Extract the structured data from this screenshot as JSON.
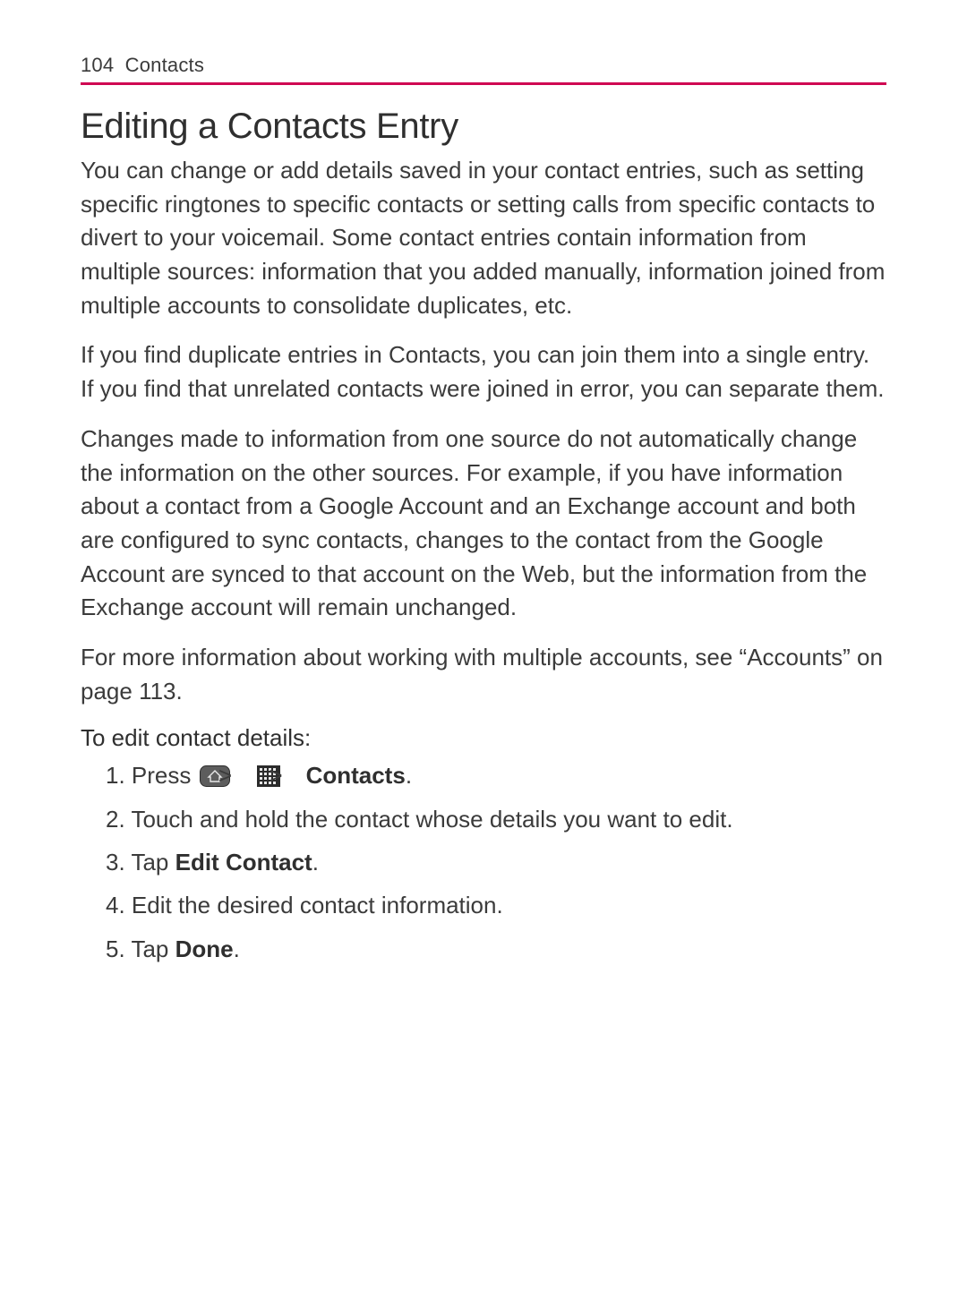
{
  "header": {
    "page_number": "104",
    "section": "Contacts"
  },
  "title": "Editing a Contacts Entry",
  "paragraphs": {
    "p1": "You can change or add details saved in your contact entries, such as setting specific ringtones to specific contacts or setting calls from specific contacts to divert to your voicemail. Some contact entries contain information from multiple sources: information that you added manually, information joined from multiple accounts to consolidate duplicates, etc.",
    "p2": "If you find duplicate entries in Contacts, you can join them into a single entry. If you find that unrelated contacts were joined in error, you can separate them.",
    "p3": "Changes made to information from one source do not automatically change the information on the other sources. For example, if you have information about a contact from a Google Account and an Exchange account and both are configured to sync contacts, changes to the contact from the Google Account are synced to that account on the Web, but the information from the Exchange account will remain unchanged.",
    "p4": "For more information about working with multiple accounts, see “Accounts” on page 113."
  },
  "subhead": "To edit contact details:",
  "steps": {
    "s1_num": "1.",
    "s1_press": "Press",
    "s1_gt": ">",
    "s1_contacts": "Contacts",
    "s1_period": ".",
    "s2_num": "2.",
    "s2_text": "Touch and hold the contact whose details you want to edit.",
    "s3_num": "3.",
    "s3_tap": "Tap ",
    "s3_bold": "Edit Contact",
    "s3_period": ".",
    "s4_num": "4.",
    "s4_text": "Edit the desired contact information.",
    "s5_num": "5.",
    "s5_tap": "Tap ",
    "s5_bold": "Done",
    "s5_period": "."
  }
}
